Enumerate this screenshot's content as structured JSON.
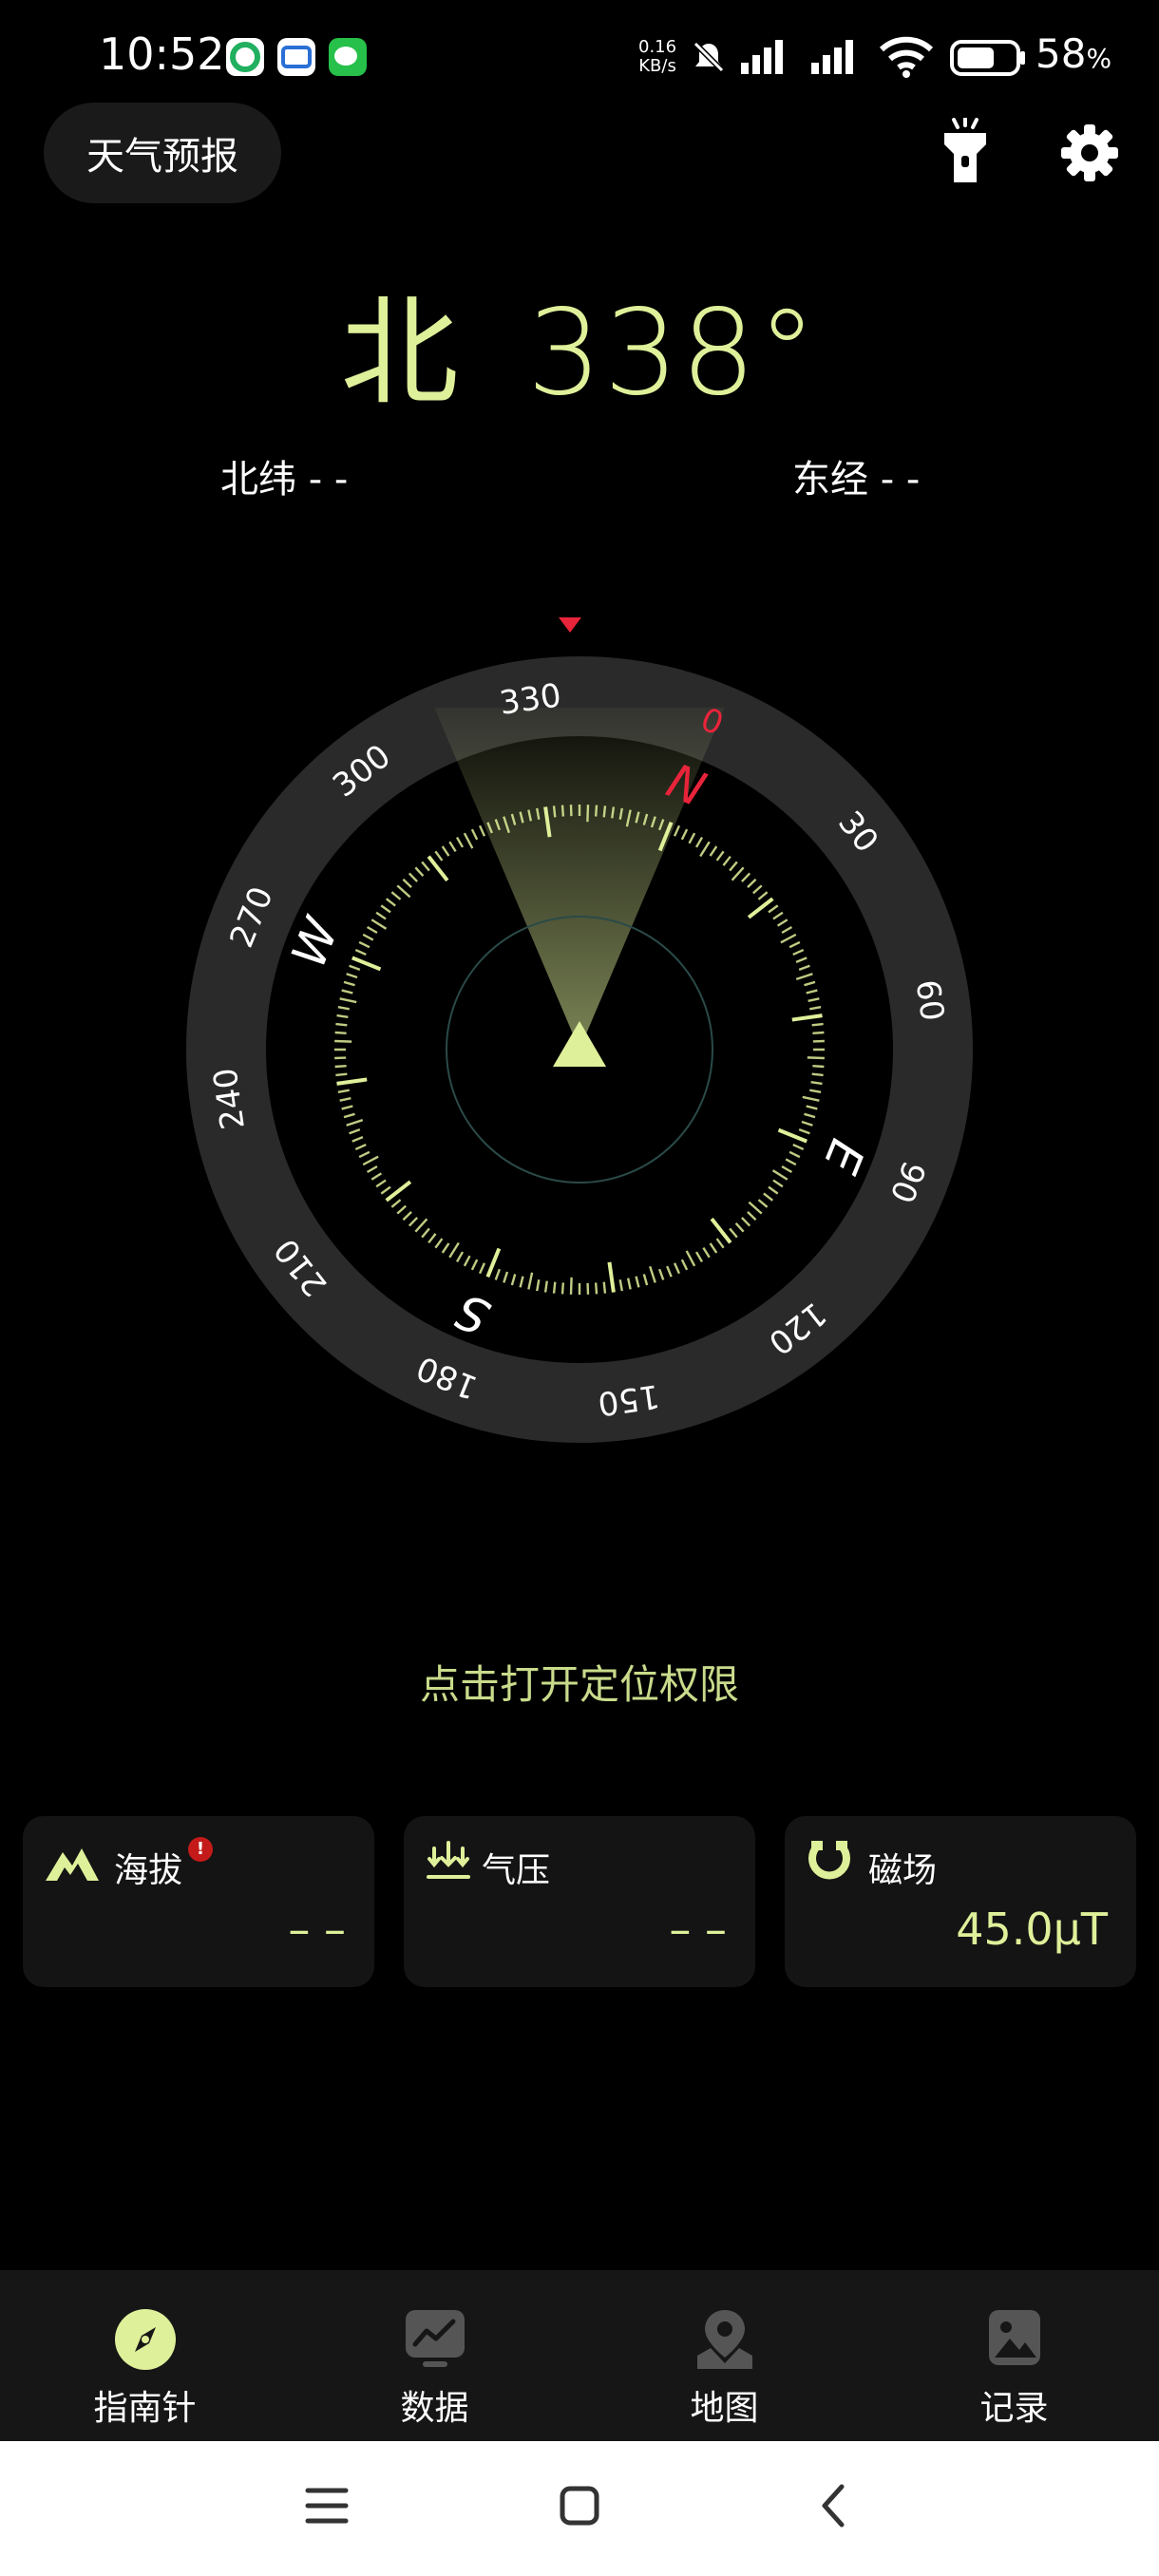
{
  "status_bar": {
    "time": "10:52",
    "net_speed_value": "0.16",
    "net_speed_unit": "KB/s",
    "battery": "58",
    "battery_unit": "%"
  },
  "header": {
    "weather_button": "天气预报",
    "flashlight_icon": "flashlight-icon",
    "settings_icon": "gear-icon"
  },
  "heading": {
    "direction": "北",
    "degrees": "338°"
  },
  "location": {
    "latitude": "北纬 - -",
    "longitude": "东经 - -"
  },
  "compass": {
    "heading_deg": 338,
    "degree_labels": [
      "0",
      "30",
      "60",
      "90",
      "120",
      "150",
      "180",
      "210",
      "240",
      "270",
      "300",
      "330"
    ],
    "cardinals": [
      "N",
      "E",
      "S",
      "W"
    ],
    "accent_color": "#dff09a",
    "north_color": "#e8243a"
  },
  "permission_prompt": "点击打开定位权限",
  "cards": [
    {
      "label": "海拔",
      "value": "– –",
      "icon": "mountain-icon"
    },
    {
      "label": "气压",
      "value": "– –",
      "icon": "pressure-icon"
    },
    {
      "label": "磁场",
      "value": "45.0μT",
      "icon": "magnet-icon"
    }
  ],
  "bottom_nav": [
    {
      "label": "指南针",
      "icon": "compass-icon",
      "active": true
    },
    {
      "label": "数据",
      "icon": "chart-icon",
      "active": false
    },
    {
      "label": "地图",
      "icon": "map-pin-icon",
      "active": false
    },
    {
      "label": "记录",
      "icon": "photo-icon",
      "active": false
    }
  ]
}
